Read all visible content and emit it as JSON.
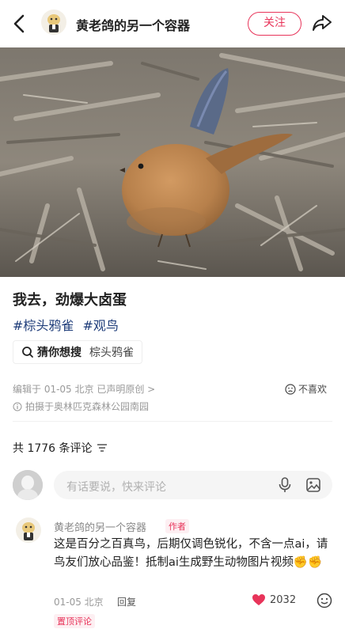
{
  "header": {
    "author_name": "黄老鸽的另一个容器",
    "follow_label": "关注",
    "icons": [
      "back-arrow-icon",
      "share-icon"
    ]
  },
  "post": {
    "title": "我去，劲爆大卤蛋",
    "tags": [
      "#棕头鸦雀",
      "#观鸟"
    ],
    "guess": {
      "label": "猜你想搜",
      "term": "棕头鸦雀"
    },
    "meta": "编辑于 01-05 北京 已声明原创 >",
    "location": "拍摄于奥林匹克森林公园南园",
    "dislike_label": "不喜欢"
  },
  "comments_section": {
    "count_label": "共 1776 条评论",
    "input_placeholder": "有话要说，快来评论"
  },
  "comment": {
    "author": "黄老鸽的另一个容器",
    "badge": "作者",
    "text": "这是百分之百真鸟，后期仅调色锐化，不含一点ai，请鸟友们放心品鉴！抵制ai生成野生动物图片视频✊✊",
    "time": "01-05 北京",
    "reply_label": "回复",
    "likes": "2032",
    "pinned_label": "置顶评论"
  },
  "colors": {
    "accent": "#e8345a",
    "tag": "#1f3d7a"
  }
}
